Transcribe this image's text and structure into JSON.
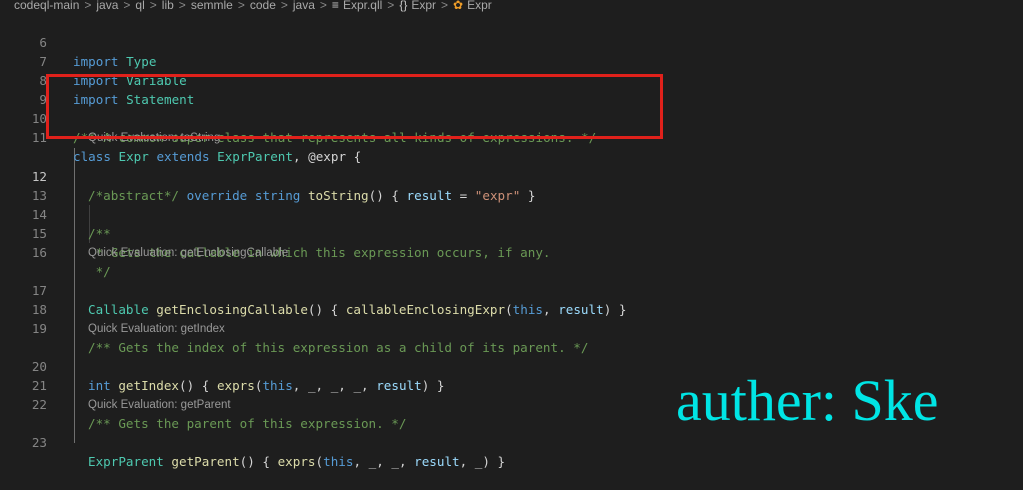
{
  "breadcrumb": {
    "segments": [
      "codeql-main",
      "java",
      "ql",
      "lib",
      "semmle",
      "code",
      "java"
    ],
    "file": "Expr.qll",
    "module": "Expr",
    "class": "Expr",
    "separator": ">"
  },
  "code": {
    "l6": {
      "num": "6",
      "kw": "import",
      "name": "Type"
    },
    "l7": {
      "num": "7",
      "kw": "import",
      "name": "Variable"
    },
    "l8": {
      "num": "8",
      "kw": "import",
      "name": "Statement"
    },
    "l9": {
      "num": "9"
    },
    "l10": {
      "num": "10",
      "comment": "/** A common super-class that represents all kinds of expressions. */"
    },
    "l11": {
      "num": "11",
      "kw_class": "class",
      "name": "Expr",
      "kw_extends": "extends",
      "parent": "ExprParent",
      "rest": ", @expr {"
    },
    "lens_tostring": "Quick Evaluation: toString",
    "l12": {
      "num": "12",
      "comment": "/*abstract*/",
      "kw_override": "override",
      "kw_string": "string",
      "fn": "toString",
      "p1": "() { ",
      "var": "result",
      "eq": " = ",
      "str": "\"expr\"",
      "close": " }"
    },
    "l13": {
      "num": "13"
    },
    "l14": {
      "num": "14",
      "comment": "/**"
    },
    "l15": {
      "num": "15",
      "comment": " * Gets the callable in which this expression occurs, if any."
    },
    "l16": {
      "num": "16",
      "comment": " */"
    },
    "lens_enclosing": "Quick Evaluation: getEnclosingCallable",
    "l17": {
      "num": "17",
      "type": "Callable",
      "fn": "getEnclosingCallable",
      "p1": "() { ",
      "fn2": "callableEnclosingExpr",
      "p2": "(",
      "kw_this": "this",
      "p3": ", ",
      "var": "result",
      "p4": ") }"
    },
    "l18": {
      "num": "18"
    },
    "l19": {
      "num": "19",
      "comment": "/** Gets the index of this expression as a child of its parent. */"
    },
    "lens_index": "Quick Evaluation: getIndex",
    "l20": {
      "num": "20",
      "kw_int": "int",
      "fn": "getIndex",
      "p1": "() { ",
      "fn2": "exprs",
      "p2": "(",
      "kw_this": "this",
      "p3": ", _, _, _, ",
      "var": "result",
      "p4": ") }"
    },
    "l21": {
      "num": "21"
    },
    "l22": {
      "num": "22",
      "comment": "/** Gets the parent of this expression. */"
    },
    "lens_parent": "Quick Evaluation: getParent",
    "l23": {
      "num": "23",
      "type": "ExprParent",
      "fn": "getParent",
      "p1": "() { ",
      "fn2": "exprs",
      "p2": "(",
      "kw_this": "this",
      "p3": ", _, _, ",
      "var": "result",
      "p4": ", _) }"
    }
  },
  "watermark": "auther: Ske",
  "colors": {
    "background": "#1e1e1e",
    "keyword": "#569cd6",
    "type": "#4ec9b0",
    "function": "#dcdcaa",
    "variable": "#9cdcfe",
    "string": "#ce9178",
    "comment": "#6a9955",
    "highlight_box": "#e0211b",
    "watermark": "#00e5e5"
  }
}
